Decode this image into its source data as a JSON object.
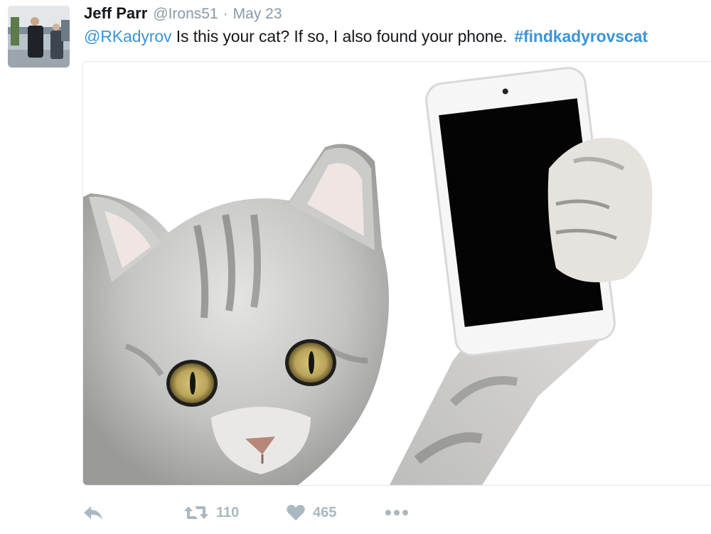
{
  "tweet": {
    "author_name": "Jeff Parr",
    "author_handle": "@Irons51",
    "separator": "·",
    "date": "May 23",
    "mention": "@RKadyrov",
    "body": " Is this your cat? If so, I also found your phone.",
    "hashtag": "#findkadyrovscat"
  },
  "media": {
    "alt": "photo of a grey tabby cat holding a white smartphone"
  },
  "actions": {
    "reply_icon": "reply-icon",
    "retweet_icon": "retweet-icon",
    "retweet_count": "110",
    "like_icon": "heart-icon",
    "like_count": "465",
    "more_icon": "more-icon"
  },
  "colors": {
    "link": "#3b94d9",
    "muted": "#8899a6",
    "action": "#aab8c2"
  }
}
